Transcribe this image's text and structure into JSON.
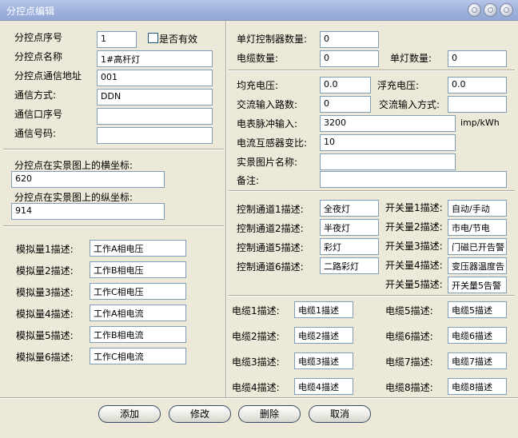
{
  "window": {
    "title": "分控点编辑"
  },
  "left": {
    "seq_label": "分控点序号",
    "seq_value": "1",
    "valid_label": "是否有效",
    "name_label": "分控点名称",
    "name_value": "1#高杆灯",
    "addr_label": "分控点通信地址",
    "addr_value": "001",
    "mode_label": "通信方式:",
    "mode_value": "DDN",
    "port_label": "通信口序号",
    "port_value": "",
    "num_label": "通信号码:",
    "num_value": "",
    "xcoord_label": "分控点在实景图上的横坐标:",
    "xcoord_value": "620",
    "ycoord_label": "分控点在实景图上的纵坐标:",
    "ycoord_value": "914",
    "analog": [
      {
        "label": "模拟量1描述:",
        "value": "工作A相电压"
      },
      {
        "label": "模拟量2描述:",
        "value": "工作B相电压"
      },
      {
        "label": "模拟量3描述:",
        "value": "工作C相电压"
      },
      {
        "label": "模拟量4描述:",
        "value": "工作A相电流"
      },
      {
        "label": "模拟量5描述:",
        "value": "工作B相电流"
      },
      {
        "label": "模拟量6描述:",
        "value": "工作C相电流"
      }
    ]
  },
  "right": {
    "lamp_ctrl_label": "单灯控制器数量:",
    "lamp_ctrl_value": "0",
    "cable_count_label": "电缆数量:",
    "cable_count_value": "0",
    "lamp_count_label": "单灯数量:",
    "lamp_count_value": "0",
    "eq_label": "均充电压:",
    "eq_value": "0.0",
    "float_label": "浮充电压:",
    "float_value": "0.0",
    "ac_ch_label": "交流输入路数:",
    "ac_ch_value": "0",
    "ac_mode_label": "交流输入方式:",
    "ac_mode_value": "",
    "pulse_label": "电表脉冲输入:",
    "pulse_value": "3200",
    "pulse_unit": "imp/kWh",
    "ct_label": "电流互感器变比:",
    "ct_value": "10",
    "img_label": "实景图片名称:",
    "img_value": "",
    "note_label": "备注:",
    "note_value": "",
    "channels": [
      {
        "label": "控制通道1描述:",
        "value": "全夜灯"
      },
      {
        "label": "控制通道2描述:",
        "value": "半夜灯"
      },
      {
        "label": "控制通道5描述:",
        "value": "彩灯"
      },
      {
        "label": "控制通道6描述:",
        "value": "二路彩灯"
      }
    ],
    "switches": [
      {
        "label": "开关量1描述:",
        "value": "自动/手动"
      },
      {
        "label": "开关量2描述:",
        "value": "市电/节电"
      },
      {
        "label": "开关量3描述:",
        "value": "门磁已开告警"
      },
      {
        "label": "开关量4描述:",
        "value": "变压器温度告"
      },
      {
        "label": "开关量5描述:",
        "value": "开关量5告警"
      }
    ],
    "cables_left": [
      {
        "label": "电缆1描述:",
        "value": "电缆1描述"
      },
      {
        "label": "电缆2描述:",
        "value": "电缆2描述"
      },
      {
        "label": "电缆3描述:",
        "value": "电缆3描述"
      },
      {
        "label": "电缆4描述:",
        "value": "电缆4描述"
      }
    ],
    "cables_right": [
      {
        "label": "电缆5描述:",
        "value": "电缆5描述"
      },
      {
        "label": "电缆6描述:",
        "value": "电缆6描述"
      },
      {
        "label": "电缆7描述:",
        "value": "电缆7描述"
      },
      {
        "label": "电缆8描述:",
        "value": "电缆8描述"
      }
    ]
  },
  "buttons": {
    "add": "添加",
    "edit": "修改",
    "delete": "删除",
    "cancel": "取消"
  }
}
